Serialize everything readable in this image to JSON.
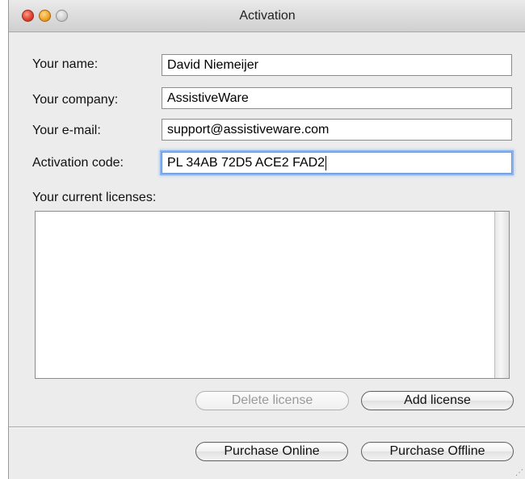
{
  "window": {
    "title": "Activation"
  },
  "form": {
    "name_label": "Your name:",
    "name_value": "David Niemeijer",
    "company_label": "Your company:",
    "company_value": "AssistiveWare",
    "email_label": "Your e-mail:",
    "email_value": "support@assistiveware.com",
    "code_label": "Activation code:",
    "code_value": "PL 34AB 72D5 ACE2 FAD2"
  },
  "licenses": {
    "label": "Your current licenses:",
    "items": []
  },
  "buttons": {
    "delete_license": "Delete license",
    "add_license": "Add license",
    "purchase_online": "Purchase Online",
    "purchase_offline": "Purchase Offline"
  }
}
